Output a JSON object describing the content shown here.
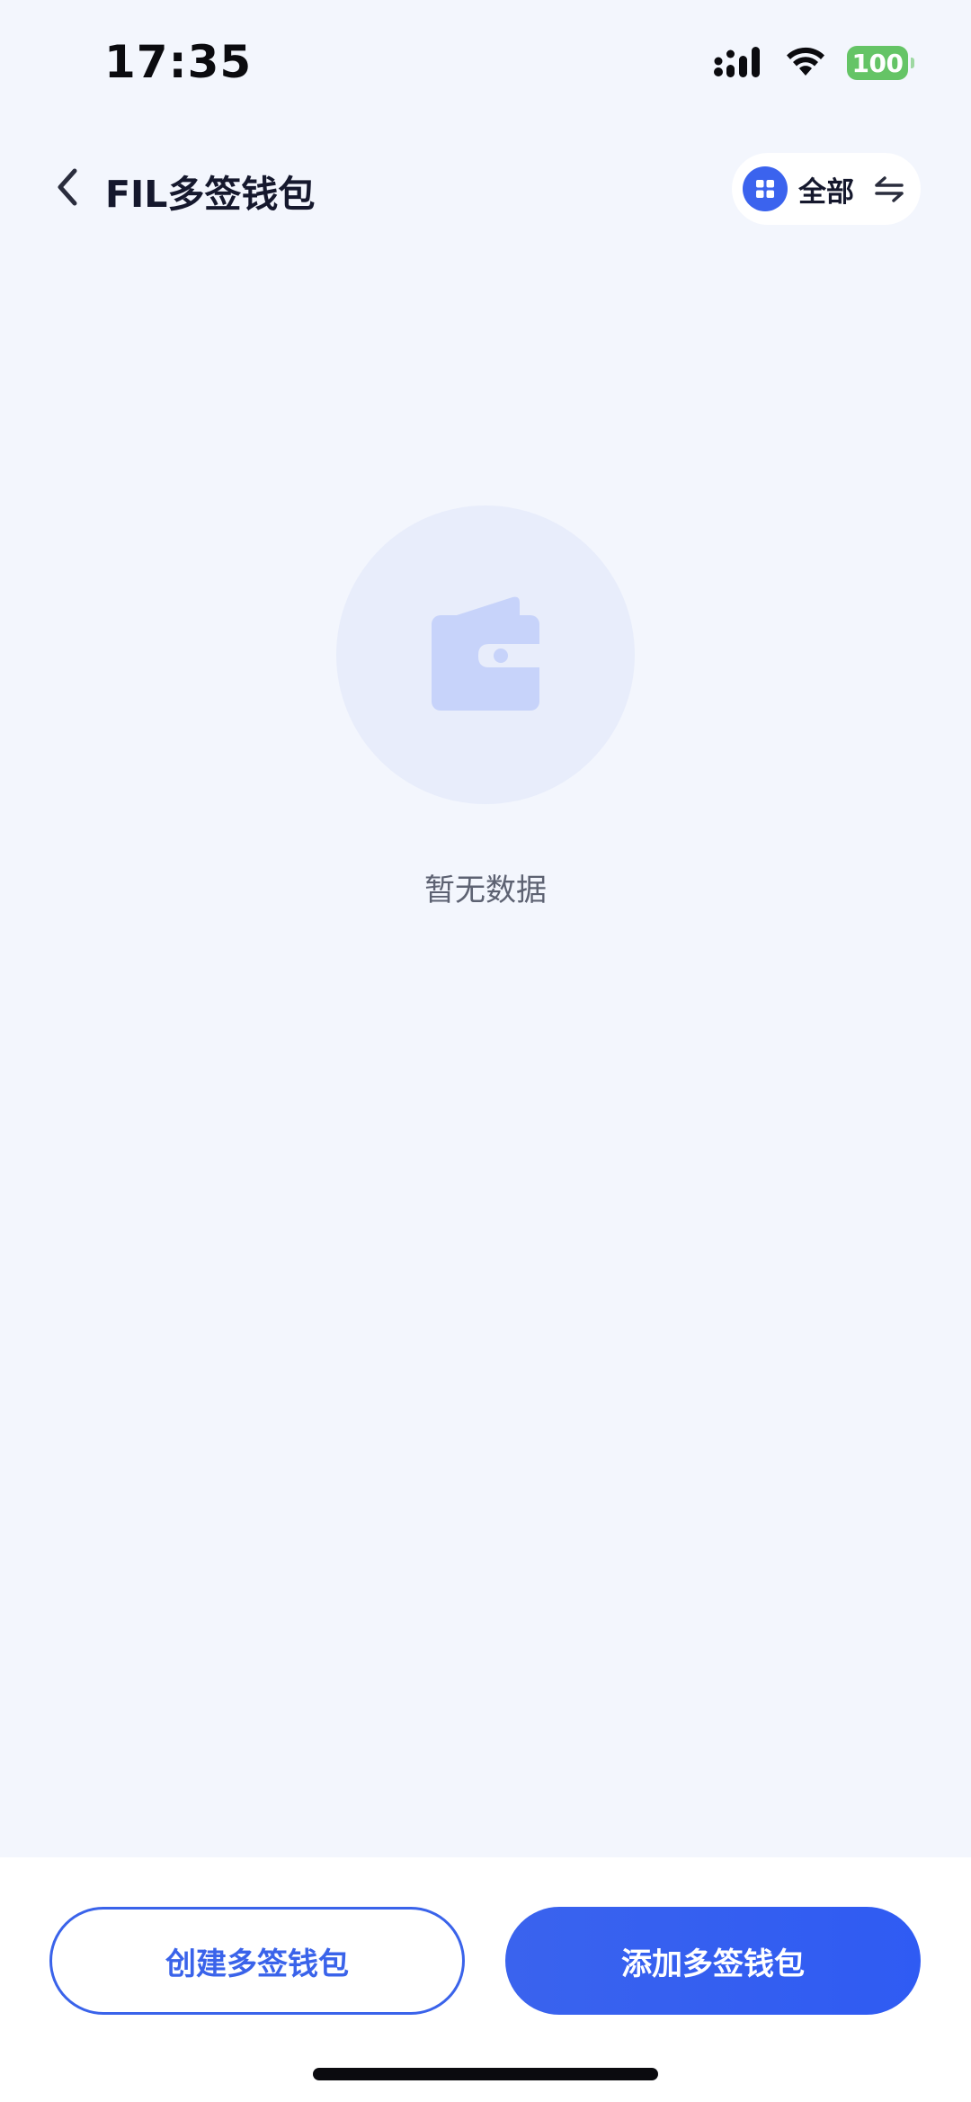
{
  "status_bar": {
    "time": "17:35",
    "battery": "100"
  },
  "header": {
    "title": "FIL多签钱包",
    "filter_label": "全部"
  },
  "empty_state": {
    "message": "暂无数据"
  },
  "actions": {
    "create_label": "创建多签钱包",
    "add_label": "添加多签钱包"
  },
  "colors": {
    "accent": "#3a63ee",
    "background": "#f3f6fd",
    "battery": "#65c466"
  },
  "icons": {
    "back": "chevron-left-icon",
    "filter": "grid-icon",
    "swap": "swap-arrows-icon",
    "empty": "wallet-icon"
  }
}
